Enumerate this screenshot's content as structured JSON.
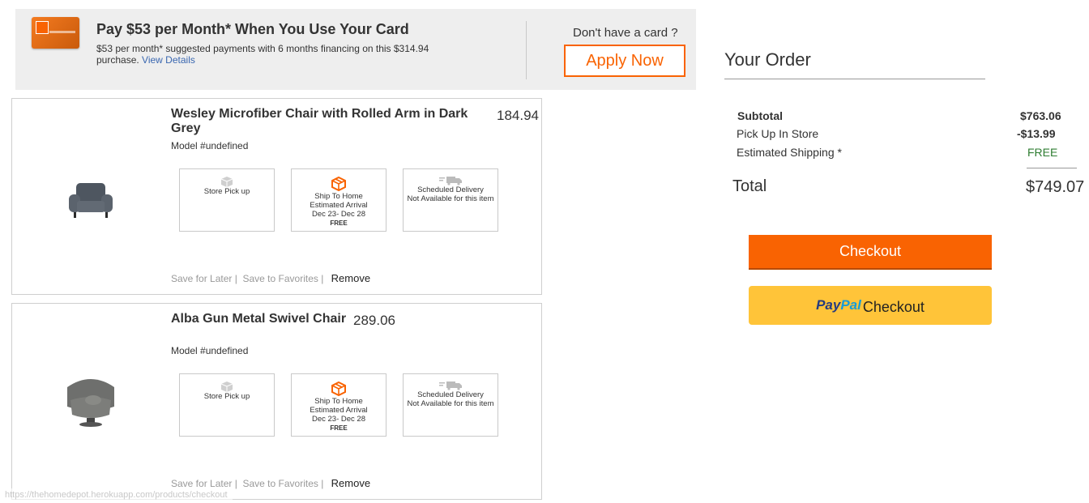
{
  "promo": {
    "title": "Pay $53 per Month* When You Use Your Card",
    "description": "$53 per month* suggested payments with 6 months financing on this $314.94 purchase.",
    "view_details": "View Details",
    "no_card_text": "Don't have a card ?",
    "apply_label": "Apply Now"
  },
  "items": [
    {
      "name": "Wesley Microfiber Chair with Rolled Arm in Dark Grey",
      "price": "184.94",
      "model": "Model #undefined",
      "store_pickup": "Store Pick up",
      "ship_home_title": "Ship To Home",
      "ship_home_eta_label": "Estimated Arrival",
      "ship_home_dates": "Dec 23- Dec 28",
      "ship_home_cost": "FREE",
      "scheduled_title": "Scheduled Delivery",
      "scheduled_note": "Not Available for this item",
      "save_later": "Save for Later |",
      "save_favorites": "Save to Favorites |",
      "remove": "Remove"
    },
    {
      "name": "Alba Gun Metal Swivel Chair",
      "price": "289.06",
      "model": "Model #undefined",
      "store_pickup": "Store Pick up",
      "ship_home_title": "Ship To Home",
      "ship_home_eta_label": "Estimated Arrival",
      "ship_home_dates": "Dec 23- Dec 28",
      "ship_home_cost": "FREE",
      "scheduled_title": "Scheduled Delivery",
      "scheduled_note": "Not Available for this item",
      "save_later": "Save for Later |",
      "save_favorites": "Save to Favorites |",
      "remove": "Remove"
    }
  ],
  "order": {
    "title": "Your Order",
    "subtotal_label": "Subtotal",
    "subtotal_value": "$763.06",
    "pickup_label": "Pick Up In Store",
    "pickup_value": "-$13.99",
    "shipping_label": "Estimated Shipping *",
    "shipping_value": "FREE",
    "total_label": "Total",
    "total_value": "$749.07",
    "checkout_label": "Checkout",
    "paypal_brand_1": "Pay",
    "paypal_brand_2": "Pal",
    "paypal_label": "Checkout"
  },
  "status_url": "https://thehomedepot.herokuapp.com/products/checkout",
  "colors": {
    "accent": "#f96302",
    "paypal_yellow": "#ffc439",
    "free_green": "#2e7d32",
    "link_blue": "#3a67b0"
  }
}
